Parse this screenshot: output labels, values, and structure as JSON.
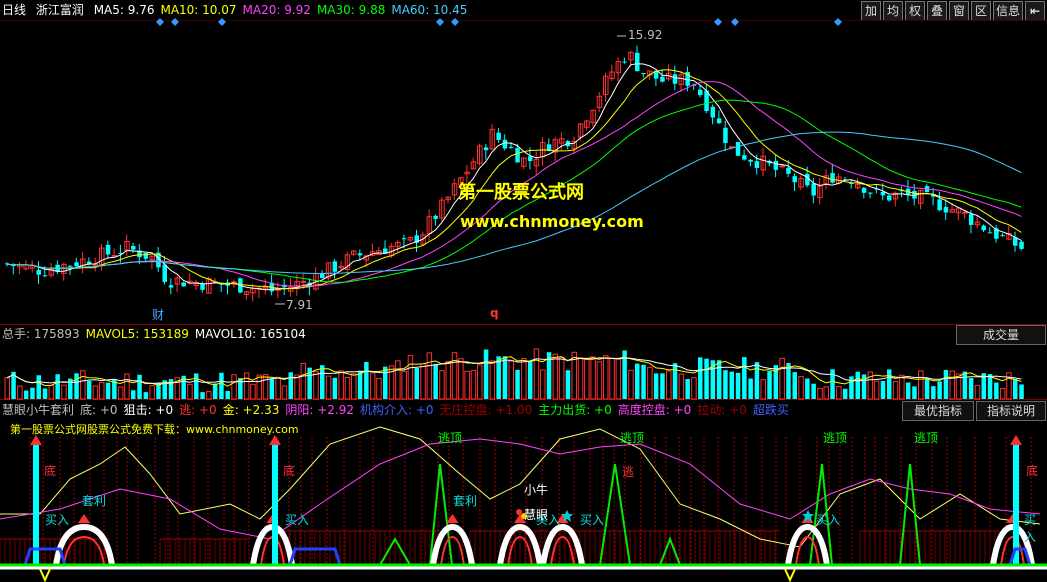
{
  "header": {
    "period": "日线",
    "stock": "浙江富润",
    "ma": [
      {
        "label": "MA5: 9.76",
        "color": "#ffffff"
      },
      {
        "label": "MA10: 10.07",
        "color": "#ffff00"
      },
      {
        "label": "MA20: 9.92",
        "color": "#ff44ff"
      },
      {
        "label": "MA30: 9.88",
        "color": "#00ff00"
      },
      {
        "label": "MA60: 10.45",
        "color": "#44ccff"
      }
    ],
    "toolbar": [
      "加",
      "均",
      "权",
      "叠",
      "窗",
      "区",
      "信息"
    ],
    "nav_icon": "back-arrow-icon"
  },
  "price_chart": {
    "high_label": "15.92",
    "low_label": "7.91",
    "marker_cai": "财",
    "marker_q": "q",
    "watermark_title": "第一股票公式网",
    "watermark_url": "www.chnmoney.com"
  },
  "volume": {
    "legend": [
      {
        "label": "总手: 175893",
        "color": "#c0c0c0"
      },
      {
        "label": "MAVOL5: 153189",
        "color": "#ffff00"
      },
      {
        "label": "MAVOL10: 165104",
        "color": "#ffffff"
      }
    ],
    "button": "成交量"
  },
  "indicator": {
    "legend": [
      {
        "label": "慧眼小牛套利",
        "color": "#c0c0c0"
      },
      {
        "label": "底: +0",
        "color": "#c0c0c0"
      },
      {
        "label": "狙击: +0",
        "color": "#ffffff"
      },
      {
        "label": "逃: +0",
        "color": "#ff3030"
      },
      {
        "label": "金: +2.33",
        "color": "#ffff00"
      },
      {
        "label": "阴阳: +2.92",
        "color": "#ff44ff"
      },
      {
        "label": "机构介入: +0",
        "color": "#4060ff"
      },
      {
        "label": "无庄控盘: +1.00",
        "color": "#a00000"
      },
      {
        "label": "主力出货: +0",
        "color": "#00ff00"
      },
      {
        "label": "高度控盘: +0",
        "color": "#ff44ff"
      },
      {
        "label": "拉动: +0",
        "color": "#a00000"
      },
      {
        "label": "超跌买",
        "color": "#4060ff"
      }
    ],
    "buttons": [
      "最优指标",
      "指标说明"
    ],
    "subtitle": "第一股票公式网股票公式免费下载：www.chnmoney.com",
    "labels": {
      "di": "底",
      "taoli": "套利",
      "mairu": "买入",
      "taoding": "逃顶",
      "xiaoniu": "小牛",
      "huiyan": "慧眼",
      "tao": "逃"
    }
  }
}
